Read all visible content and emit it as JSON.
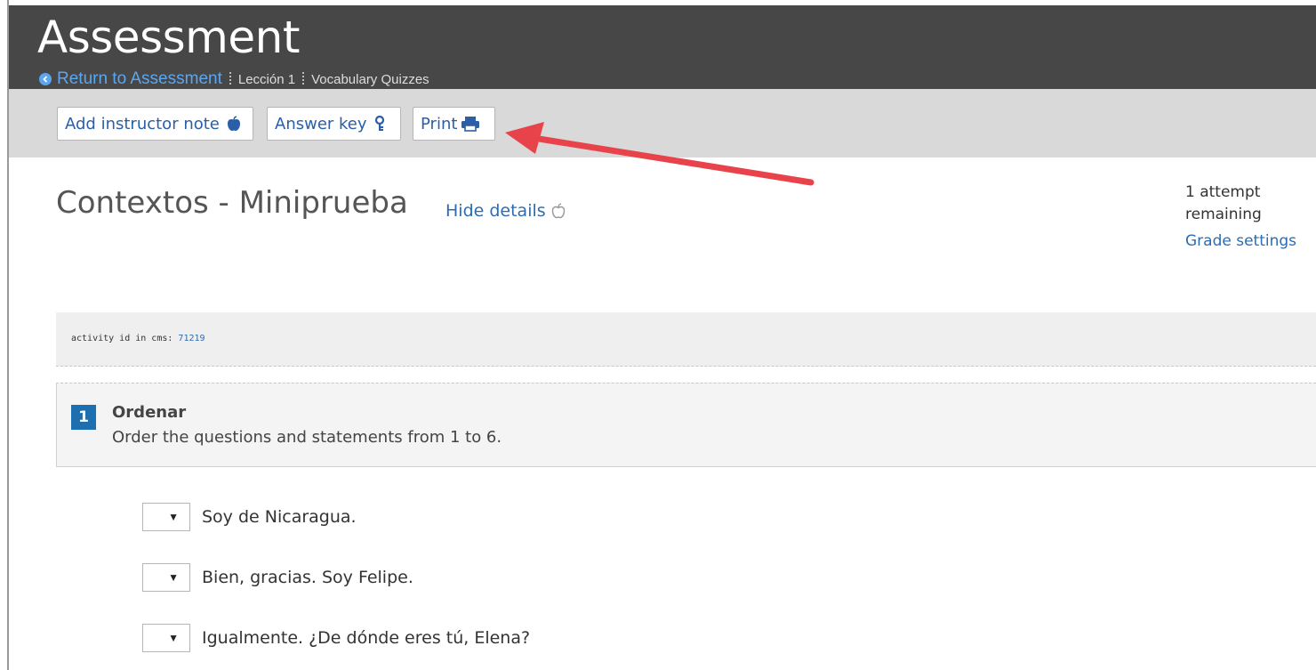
{
  "header": {
    "title": "Assessment",
    "back_link": "Return to Assessment",
    "breadcrumbs": [
      "Lección 1",
      "Vocabulary Quizzes"
    ]
  },
  "toolbar": {
    "add_note_label": "Add instructor note",
    "answer_key_label": "Answer key",
    "print_label": "Print"
  },
  "content": {
    "title": "Contextos - Miniprueba",
    "hide_details": "Hide details",
    "attempts_line1": "1 attempt",
    "attempts_line2": "remaining",
    "grade_settings": "Grade settings"
  },
  "cms": {
    "label": "activity id in cms:",
    "id": "71219"
  },
  "question": {
    "number": "1",
    "title": "Ordenar",
    "description": "Order the questions and statements from 1 to 6.",
    "items": [
      {
        "text": "Soy de Nicaragua.",
        "selected": ""
      },
      {
        "text": "Bien, gracias. Soy Felipe.",
        "selected": ""
      },
      {
        "text": "Igualmente. ¿De dónde eres tú, Elena?",
        "selected": ""
      }
    ]
  },
  "colors": {
    "header_bg": "#474747",
    "toolbar_bg": "#d9d9d9",
    "link": "#2a6db5",
    "badge": "#1e6fb0",
    "arrow": "#e8434a"
  },
  "icons": {
    "back": "arrow-left-circle-icon",
    "note": "apple-icon",
    "key": "key-icon",
    "print": "printer-icon",
    "hide": "apple-outline-icon",
    "select": "caret-down-icon"
  }
}
